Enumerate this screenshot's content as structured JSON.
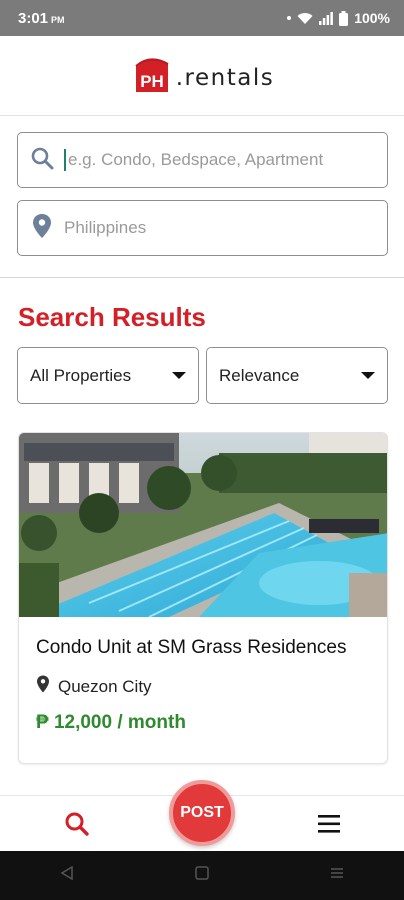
{
  "status_bar": {
    "time": "3:01",
    "ampm": "PM",
    "battery": "100%"
  },
  "header": {
    "logo_badge": "PH",
    "logo_text": ".rentals"
  },
  "search": {
    "query_placeholder": "e.g. Condo, Bedspace, Apartment",
    "location_placeholder": "Philippines"
  },
  "results": {
    "title": "Search Results"
  },
  "filters": {
    "property_type": "All Properties",
    "sort": "Relevance"
  },
  "listings": [
    {
      "title": "Condo Unit at SM Grass Residences",
      "location": "Quezon City",
      "price": "₱ 12,000 / month"
    }
  ],
  "bottom_nav": {
    "post_label": "POST"
  },
  "colors": {
    "brand_red": "#d32027",
    "price_green": "#2e8a2e",
    "post_button": "#e23a3a"
  }
}
